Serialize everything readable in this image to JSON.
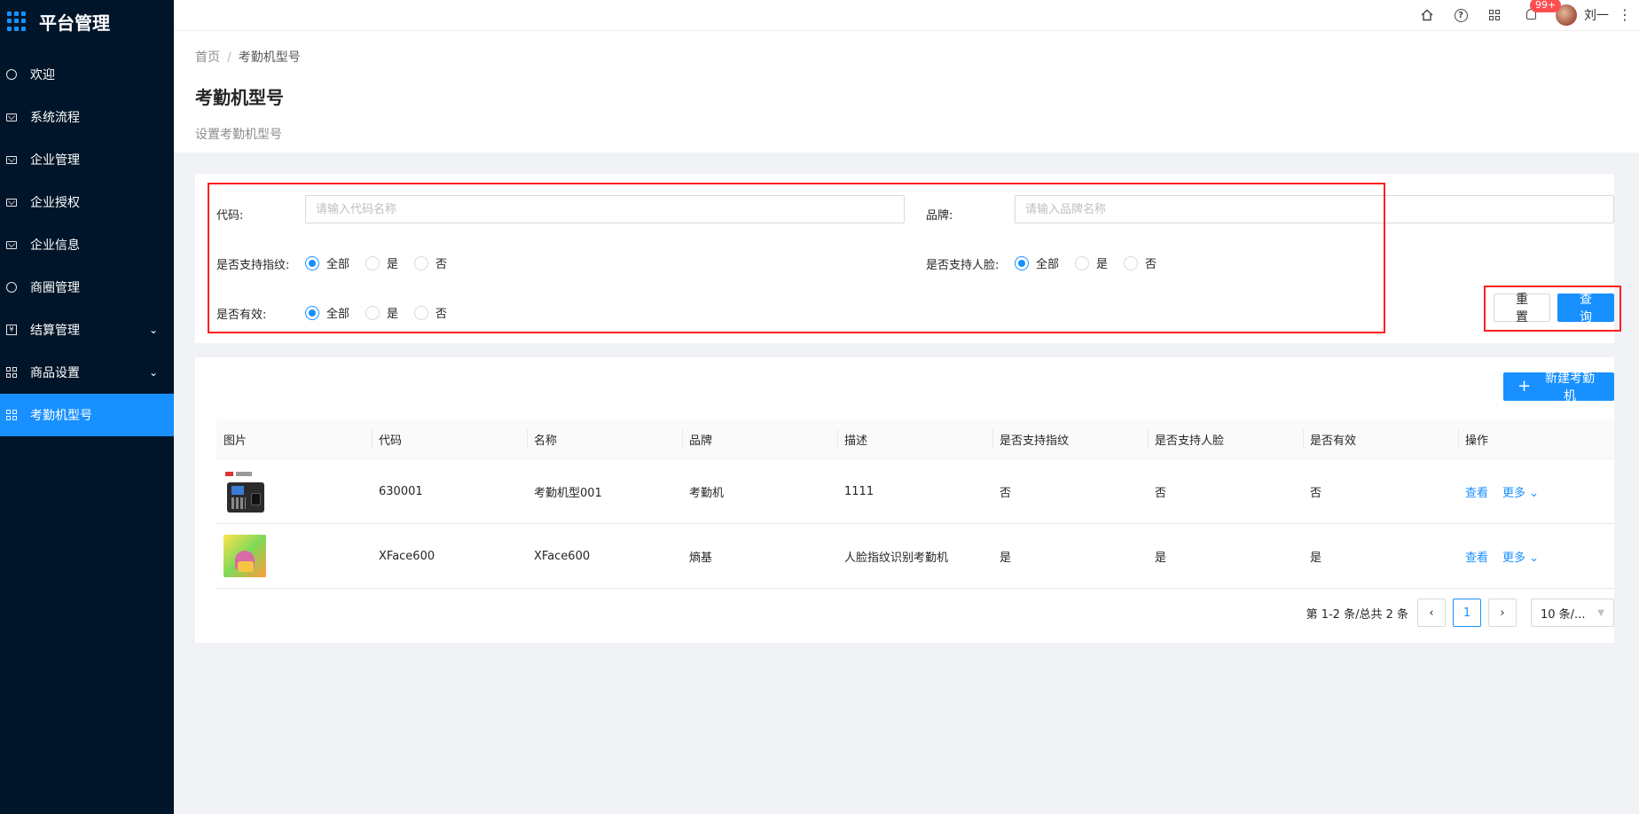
{
  "app": {
    "title": "平台管理"
  },
  "sidebar": {
    "items": [
      {
        "label": "欢迎",
        "icon": "smile-icon"
      },
      {
        "label": "系统流程",
        "icon": "mail-icon"
      },
      {
        "label": "企业管理",
        "icon": "mail-icon"
      },
      {
        "label": "企业授权",
        "icon": "mail-icon"
      },
      {
        "label": "企业信息",
        "icon": "mail-icon"
      },
      {
        "label": "商圈管理",
        "icon": "compass-icon"
      },
      {
        "label": "结算管理",
        "icon": "account-book-icon",
        "expandable": true
      },
      {
        "label": "商品设置",
        "icon": "appstore-icon",
        "expandable": true
      },
      {
        "label": "考勤机型号",
        "icon": "appstore-icon",
        "active": true
      }
    ]
  },
  "header": {
    "badge": "99+",
    "user_name": "刘一"
  },
  "page": {
    "breadcrumb": {
      "home": "首页",
      "sep": "/",
      "current": "考勤机型号"
    },
    "title": "考勤机型号",
    "description": "设置考勤机型号"
  },
  "search": {
    "code_label": "代码:",
    "code_placeholder": "请输入代码名称",
    "brand_label": "品牌:",
    "brand_placeholder": "请输入品牌名称",
    "fingerprint_label": "是否支持指纹:",
    "face_label": "是否支持人脸:",
    "valid_label": "是否有效:",
    "options": {
      "all": "全部",
      "yes": "是",
      "no": "否"
    },
    "reset_label": "重 置",
    "query_label": "查 询"
  },
  "table": {
    "new_button": "新建考勤机",
    "columns": [
      "图片",
      "代码",
      "名称",
      "品牌",
      "描述",
      "是否支持指纹",
      "是否支持人脸",
      "是否有效",
      "操作"
    ],
    "rows": [
      {
        "code": "630001",
        "name": "考勤机型001",
        "brand": "考勤机",
        "desc": "1111",
        "fingerprint": "否",
        "face": "否",
        "valid": "否",
        "view": "查看",
        "more": "更多"
      },
      {
        "code": "XFace600",
        "name": "XFace600",
        "brand": "熵基",
        "desc": "人脸指纹识别考勤机",
        "fingerprint": "是",
        "face": "是",
        "valid": "是",
        "view": "查看",
        "more": "更多"
      }
    ]
  },
  "pagination": {
    "total_text": "第 1-2 条/总共 2 条",
    "current_page": "1",
    "page_size": "10 条/..."
  },
  "colors": {
    "primary": "#1890ff",
    "sidebar_bg": "#001529",
    "highlight": "#ff1f1f"
  }
}
